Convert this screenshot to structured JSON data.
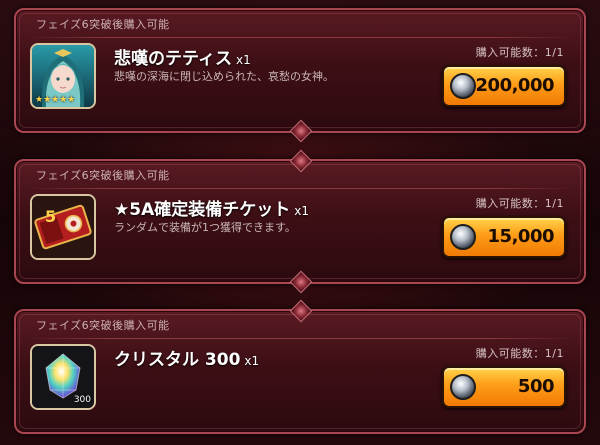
{
  "items": [
    {
      "header": "フェイズ6突破後購入可能",
      "title": "悲嘆のテティス",
      "quantity": "x1",
      "description": "悲嘆の深海に閉じ込められた、哀愁の女神。",
      "limit": "購入可能数：1/1",
      "price": "200,000",
      "icon": "character-portrait-icon",
      "stars": "★★★★★"
    },
    {
      "header": "フェイズ6突破後購入可能",
      "title": "★5A確定装備チケット",
      "quantity": "x1",
      "description": "ランダムで装備が1つ獲得できます。",
      "limit": "購入可能数：1/1",
      "price": "15,000",
      "icon": "equipment-ticket-icon",
      "ticket_label": "5"
    },
    {
      "header": "フェイズ6突破後購入可能",
      "title": "クリスタル 300",
      "quantity": "x1",
      "description": "",
      "limit": "購入可能数：1/1",
      "price": "500",
      "icon": "crystal-icon",
      "badge": "300"
    }
  ],
  "currency_icon": "silver-coin-icon",
  "colors": {
    "card_border": "#a84652",
    "button_orange": "#ff9c17",
    "button_yellow": "#ffd34a"
  }
}
